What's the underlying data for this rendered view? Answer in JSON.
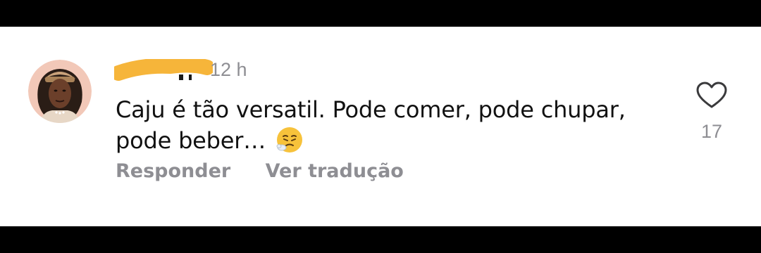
{
  "comment": {
    "username": "",
    "timestamp": "12 h",
    "text_line1": "Caju é tão versatil. Pode comer, pode chupar,",
    "text_line2": "pode beber…",
    "emoji_icon": "sweat-face-emoji-icon"
  },
  "actions": {
    "reply_label": "Responder",
    "translate_label": "Ver tradução"
  },
  "like": {
    "count": "17",
    "icon": "heart-outline-icon"
  },
  "colors": {
    "background": "#ffffff",
    "letterbox": "#000000",
    "text": "#111111",
    "muted": "#8e8e93",
    "redaction": "#f6b53a"
  }
}
